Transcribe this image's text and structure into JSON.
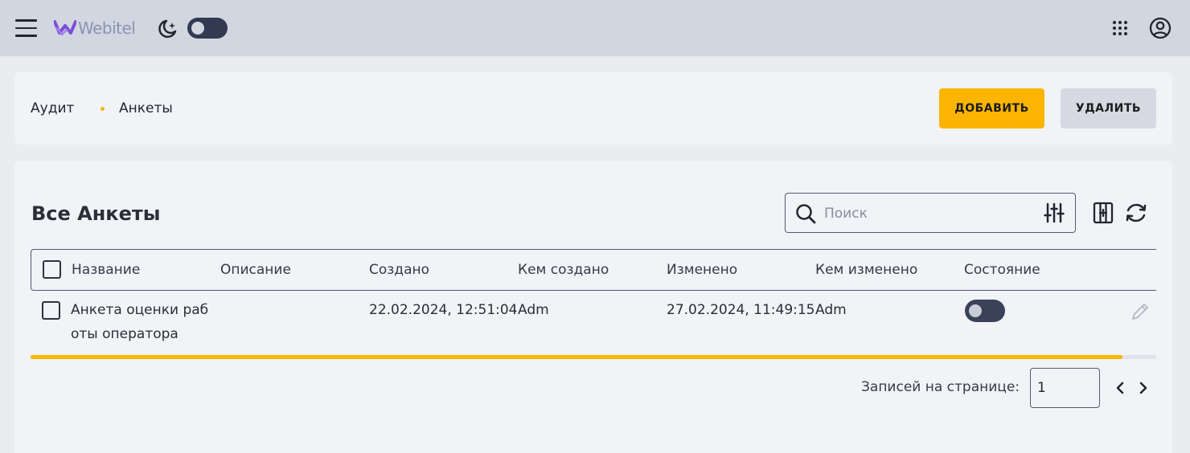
{
  "app": {
    "logo_text": "Webitel"
  },
  "colors": {
    "accent": "#fbb500",
    "topbar": "#d2d6e0",
    "card": "#f2f3f7",
    "toggle": "#323a52"
  },
  "topbar": {
    "menu_icon": "hamburger-menu-icon",
    "theme_icon": "moon-stars-icon",
    "theme_toggle_on": false,
    "apps_icon": "grid-apps-icon",
    "account_icon": "user-circle-icon"
  },
  "breadcrumb": {
    "items": [
      "Аудит",
      "Анкеты"
    ]
  },
  "actions": {
    "add_label": "ДОБАВИТЬ",
    "delete_label": "УДАЛИТЬ"
  },
  "section": {
    "title": "Все Анкеты"
  },
  "search": {
    "placeholder": "Поиск",
    "value": ""
  },
  "table": {
    "columns": [
      "Название",
      "Описание",
      "Создано",
      "Кем создано",
      "Изменено",
      "Кем изменено",
      "Состояние"
    ],
    "rows": [
      {
        "name_line1": "Анкета оценки раб",
        "name_line2": "оты оператора",
        "description": "",
        "created": "22.02.2024, 12:51:04",
        "created_by": "Adm",
        "modified": "27.02.2024, 11:49:15",
        "modified_by": "Adm",
        "state_on": false
      }
    ],
    "scroll_fraction": 0.97
  },
  "pagination": {
    "per_page_label": "Записей на странице:",
    "per_page_value": "1"
  }
}
